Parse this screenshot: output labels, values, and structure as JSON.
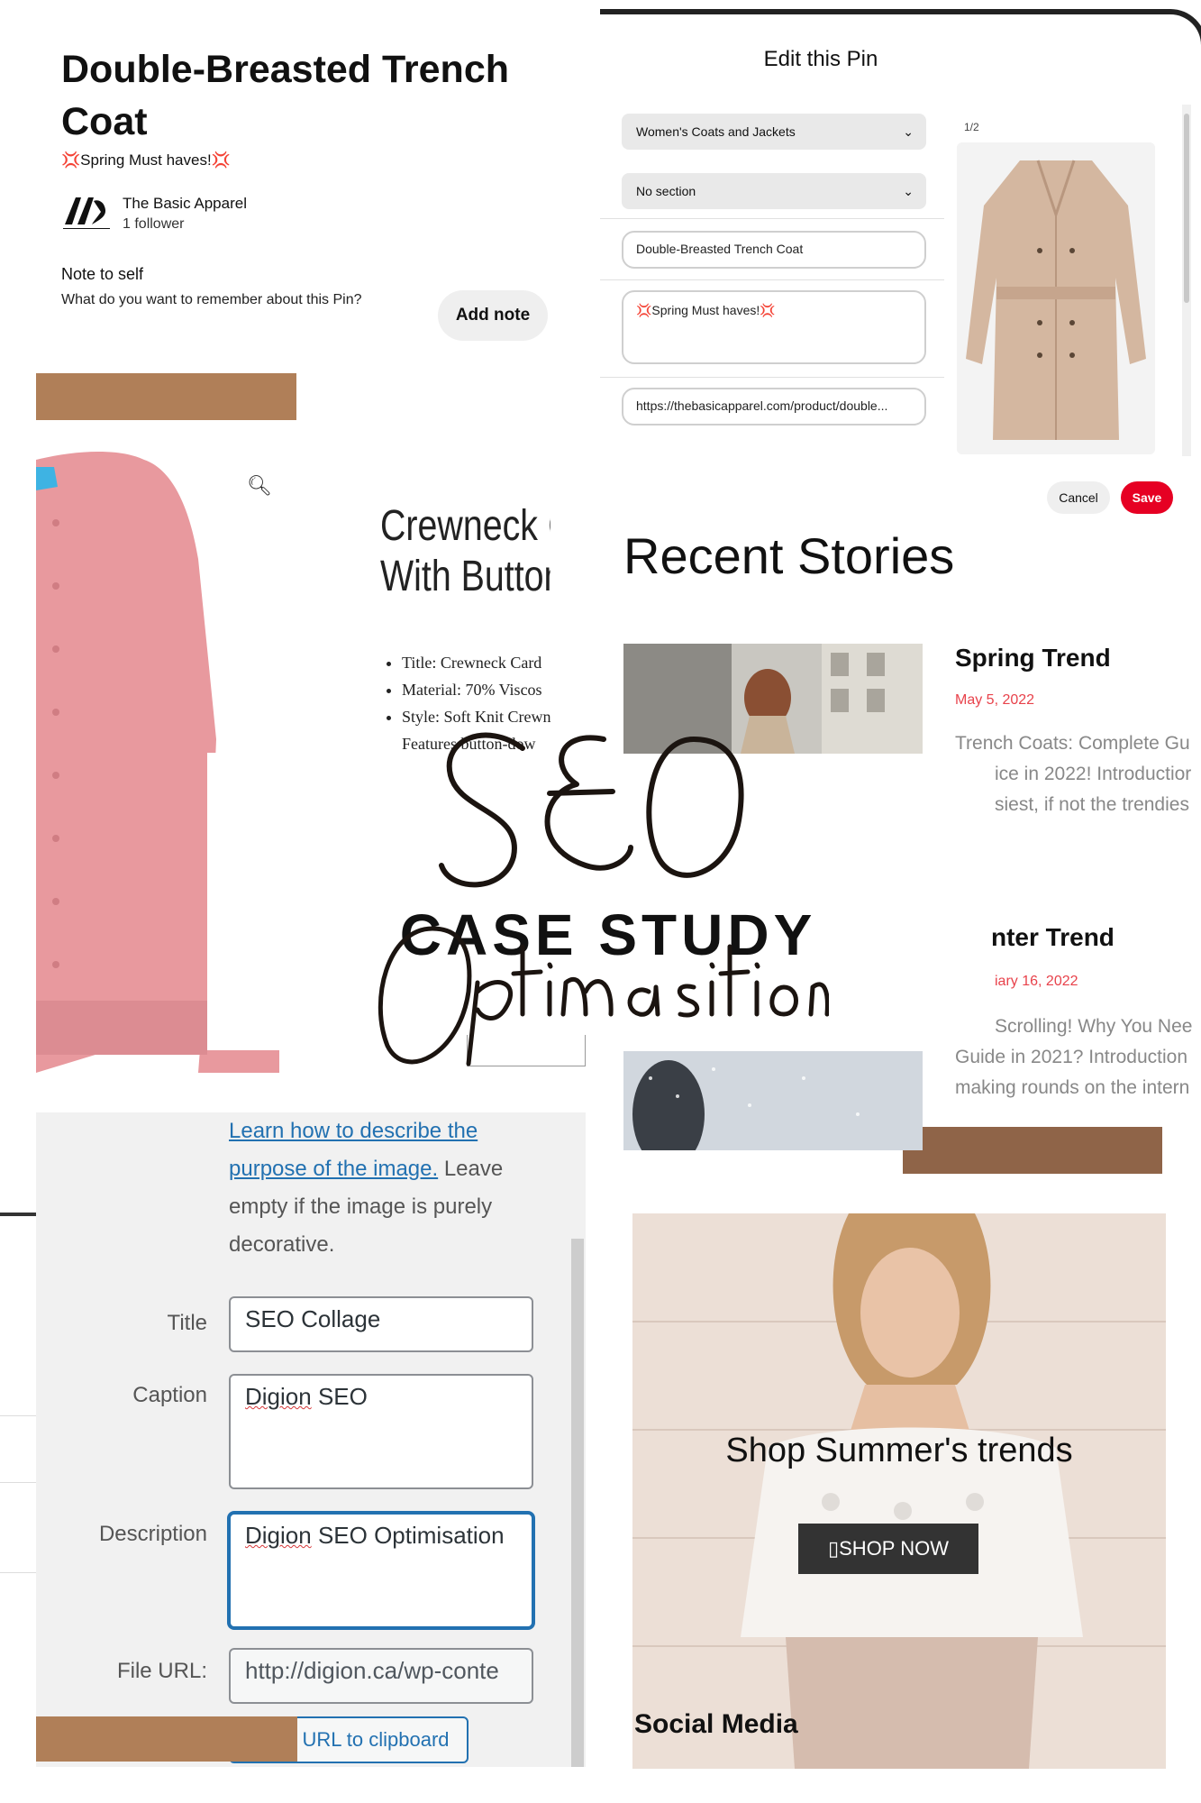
{
  "pin_info": {
    "title": "Double-Breasted Trench Coat",
    "description": "💢Spring Must haves!💢",
    "brand": "The Basic Apparel",
    "followers": "1 follower",
    "note_label": "Note to self",
    "note_question": "What do you want to remember about this Pin?",
    "add_note": "Add note"
  },
  "edit_pin": {
    "title": "Edit this Pin",
    "board": "Women's Coats and Jackets",
    "section": "No section",
    "pin_title": "Double-Breasted Trench Coat",
    "pin_description": "💢Spring Must haves!💢",
    "link": "https://thebasicapparel.com/product/double...",
    "image_counter": "1/2",
    "cancel": "Cancel",
    "save": "Save",
    "save_color": "#e60023"
  },
  "product": {
    "title_line1": "Crewneck C",
    "title_line2": "With Button",
    "bullets": [
      "Title: Crewneck Card",
      "Material:  70% Viscos",
      "Style: Soft Knit Crewn",
      "Features button-dow"
    ],
    "search_icon": "magnifier-icon"
  },
  "stories": {
    "heading": "Recent Stories",
    "items": [
      {
        "title": "Spring Trend",
        "date": "May 5, 2022",
        "excerpt": [
          "Trench Coats: Complete Gu",
          "ice in 2022! Introductior",
          "siest, if not the trendies"
        ]
      },
      {
        "title": "nter Trend",
        "date": "iary 16, 2022",
        "excerpt": [
          "Scrolling! Why You Nee",
          "Guide in 2021? Introduction",
          "making rounds on the intern"
        ]
      }
    ]
  },
  "overlay": {
    "seo": "SEO",
    "case_study": "CASE STUDY",
    "optimisation": "Optimasition"
  },
  "wp": {
    "help_link": "Learn how to describe the purpose of the image.",
    "help_rest": "Leave empty if the image is purely decorative.",
    "title_label": "Title",
    "title_value": "SEO Collage",
    "caption_label": "Caption",
    "caption_value_a": "Digion",
    "caption_value_b": " SEO",
    "description_label": "Description",
    "description_value_a": "Digion",
    "description_value_b": " SEO Optimisation",
    "file_url_label": "File URL:",
    "file_url_value": "http://digion.ca/wp-conte",
    "copy_button": "URL to clipboard"
  },
  "banner": {
    "headline": "Shop Summer's trends",
    "cta": "▯SHOP NOW",
    "caption": "Social Media"
  },
  "colors": {
    "accent_tan": "#b07f58",
    "pinterest_red": "#e60023",
    "wp_blue": "#2271b1",
    "date_red": "#e8424b"
  }
}
